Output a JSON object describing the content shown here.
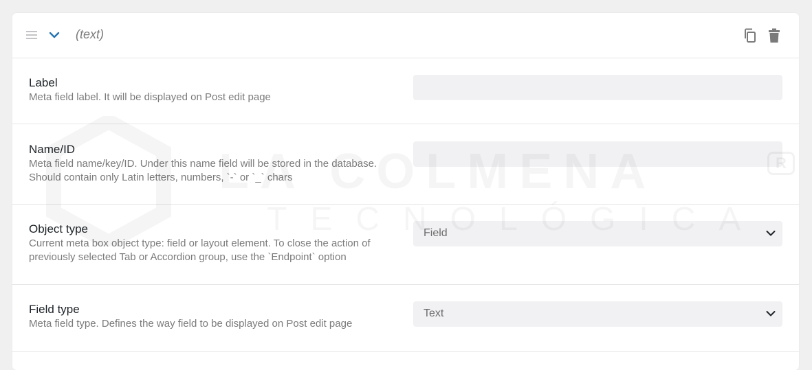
{
  "header": {
    "title": "(text)"
  },
  "fields": [
    {
      "label": "Label",
      "description": "Meta field label. It will be displayed on Post edit page",
      "value": ""
    },
    {
      "label": "Name/ID",
      "description": "Meta field name/key/ID. Under this name field will be stored in the database. Should contain only Latin letters, numbers, `-` or `_` chars",
      "value": ""
    },
    {
      "label": "Object type",
      "description": "Current meta box object type: field or layout element. To close the action of previously selected Tab or Accordion group, use the `Endpoint` option",
      "value": "Field"
    },
    {
      "label": "Field type",
      "description": "Meta field type. Defines the way field to be displayed on Post edit page",
      "value": "Text"
    }
  ],
  "watermark": {
    "line1": "LA COLMENA",
    "line2": "TECNOLÓGICA",
    "mark": "R"
  },
  "colors": {
    "accent": "#2271b1",
    "icon_gray": "#7a7a7a",
    "input_bg": "#f1f1f3"
  },
  "icons": [
    "drag-handle-icon",
    "chevron-down-icon",
    "copy-icon",
    "trash-icon"
  ]
}
